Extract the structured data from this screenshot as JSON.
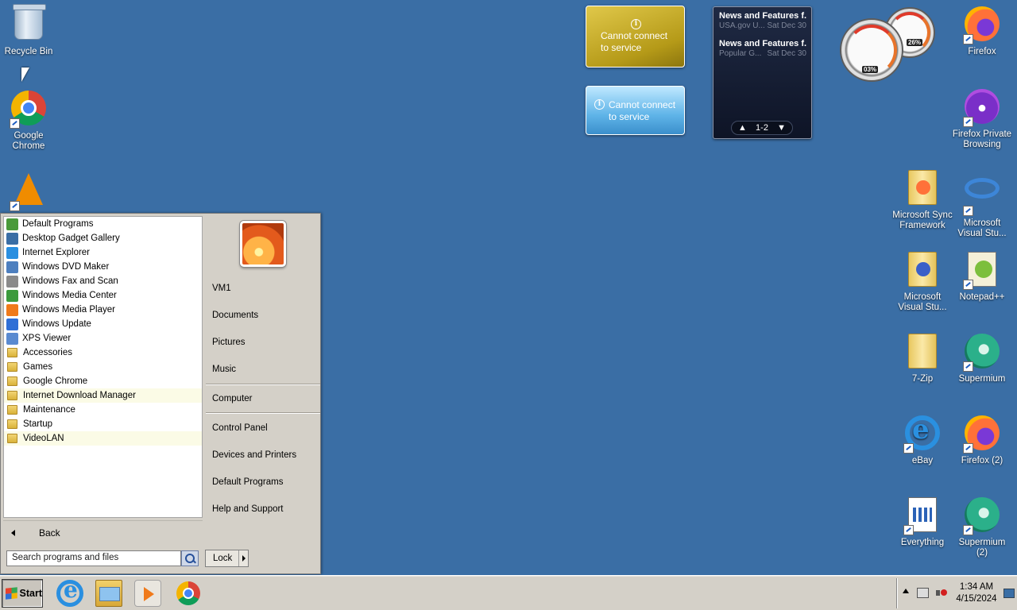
{
  "desktop_left": [
    {
      "label": "Recycle Bin",
      "icon": "recycle-bin-icon"
    },
    {
      "label": "Google Chrome",
      "icon": "chrome-icon"
    },
    {
      "label": "",
      "icon": "vlc-icon"
    }
  ],
  "desktop_right": [
    {
      "label": "Firefox"
    },
    {
      "label": "Firefox Private Browsing"
    },
    {
      "label": "Microsoft Sync Framework"
    },
    {
      "label": "Microsoft Visual Stu..."
    },
    {
      "label": "Microsoft Visual Stu..."
    },
    {
      "label": "Notepad++"
    },
    {
      "label": "7-Zip"
    },
    {
      "label": "Supermium"
    },
    {
      "label": "eBay"
    },
    {
      "label": "Firefox (2)"
    },
    {
      "label": "Everything"
    },
    {
      "label": "Supermium (2)"
    }
  ],
  "gadgets": {
    "currency": {
      "message": "Cannot connect to service"
    },
    "weather": {
      "message": "Cannot connect to service"
    },
    "feed": {
      "items": [
        {
          "title": "News and Features f...",
          "source": "USA.gov U...",
          "date": "Sat Dec 30"
        },
        {
          "title": "News and Features f...",
          "source": "Popular G...",
          "date": "Sat Dec 30"
        }
      ],
      "pager": "1-2"
    },
    "meter": {
      "cpu": "03%",
      "memory": "26%"
    }
  },
  "start_menu": {
    "programs": [
      {
        "label": "Default Programs",
        "kind": "app",
        "color": "#4a9a3a"
      },
      {
        "label": "Desktop Gadget Gallery",
        "kind": "app",
        "color": "#3a6ea5"
      },
      {
        "label": "Internet Explorer",
        "kind": "app",
        "color": "#2a8fe0"
      },
      {
        "label": "Windows DVD Maker",
        "kind": "app",
        "color": "#4d7fbf"
      },
      {
        "label": "Windows Fax and Scan",
        "kind": "app",
        "color": "#8a8a8a"
      },
      {
        "label": "Windows Media Center",
        "kind": "app",
        "color": "#3c9a3c"
      },
      {
        "label": "Windows Media Player",
        "kind": "app",
        "color": "#f07a1a"
      },
      {
        "label": "Windows Update",
        "kind": "app",
        "color": "#2f6fd6"
      },
      {
        "label": "XPS Viewer",
        "kind": "app",
        "color": "#5a8ad0"
      },
      {
        "label": "Accessories",
        "kind": "folder"
      },
      {
        "label": "Games",
        "kind": "folder"
      },
      {
        "label": "Google Chrome",
        "kind": "folder"
      },
      {
        "label": "Internet Download Manager",
        "kind": "folder",
        "highlight": true
      },
      {
        "label": "Maintenance",
        "kind": "folder"
      },
      {
        "label": "Startup",
        "kind": "folder"
      },
      {
        "label": "VideoLAN",
        "kind": "folder",
        "highlight": true
      }
    ],
    "back_label": "Back",
    "search_placeholder": "Search programs and files",
    "places": {
      "user": "VM1",
      "documents": "Documents",
      "pictures": "Pictures",
      "music": "Music",
      "computer": "Computer",
      "control_panel": "Control Panel",
      "devices": "Devices and Printers",
      "default_programs": "Default Programs",
      "help": "Help and Support"
    },
    "lock_label": "Lock"
  },
  "taskbar": {
    "start_label": "Start",
    "time": "1:34 AM",
    "date": "4/15/2024"
  }
}
